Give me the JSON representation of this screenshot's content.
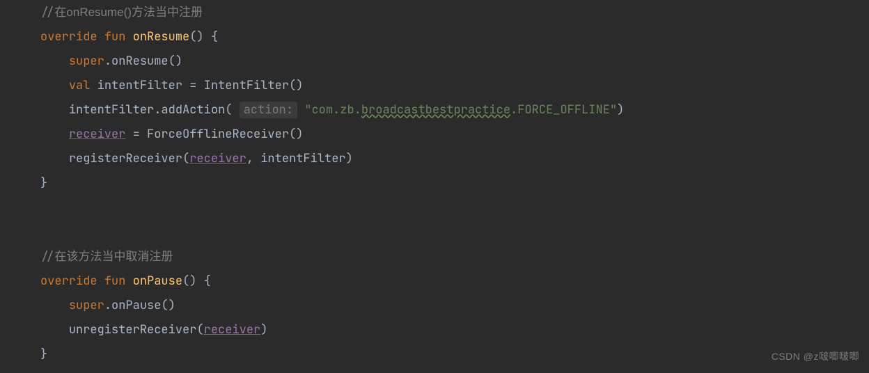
{
  "code": {
    "c1_prefix": "//",
    "c1_ident": "在onResume()",
    "c1_tail": "方法当中注册",
    "kw_override": "override",
    "kw_fun": "fun",
    "fn_onResume": "onResume",
    "kw_super": "super",
    "m_onResume": "onResume",
    "kw_val": "val",
    "id_intentFilter": "intentFilter",
    "ctor_IntentFilter": "IntentFilter",
    "m_addAction": "addAction",
    "hint_action": "action:",
    "str_open": "\"com.zb.",
    "str_wavy": "broadcastbestpractice",
    "str_close": ".FORCE_OFFLINE\"",
    "ref_receiver": "receiver",
    "ctor_ForceOfflineReceiver": "ForceOfflineReceiver",
    "m_registerReceiver": "registerReceiver",
    "c2_prefix": "//",
    "c2_tail": "在该方法当中取消注册",
    "fn_onPause": "onPause",
    "m_onPause": "onPause",
    "m_unregisterReceiver": "unregisterReceiver"
  },
  "watermark": "CSDN @z啵唧啵唧"
}
